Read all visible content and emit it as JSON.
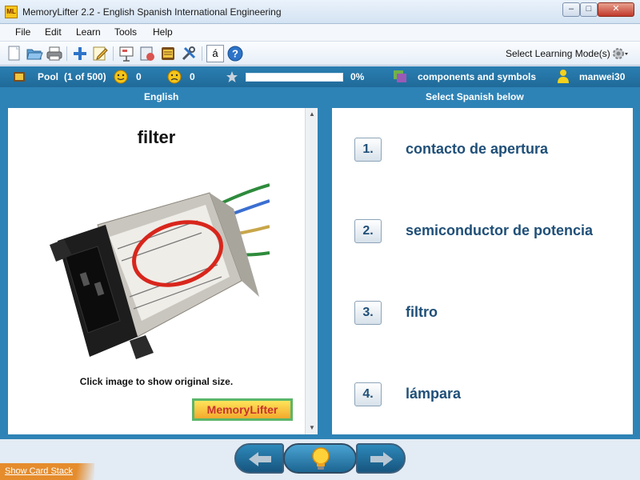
{
  "window": {
    "title": "MemoryLifter 2.2 - English Spanish International Engineering",
    "app_icon_text": "ML"
  },
  "menu": {
    "items": [
      "File",
      "Edit",
      "Learn",
      "Tools",
      "Help"
    ]
  },
  "toolbar": {
    "learning_mode_label": "Select Learning Mode(s)",
    "accent_key_label": "á"
  },
  "status": {
    "pool_label": "Pool",
    "pool_count": "(1 of 500)",
    "right_count": "0",
    "wrong_count": "0",
    "progress_text": "0%",
    "progress_fraction": 0,
    "chapter": "components and symbols",
    "user": "manwei30"
  },
  "question_panel": {
    "header": "English",
    "word": "filter",
    "caption": "Click image to show original size.",
    "logo_text": "MemoryLifter"
  },
  "answer_panel": {
    "header": "Select Spanish below",
    "answers": [
      {
        "num": "1.",
        "text": "contacto de apertura"
      },
      {
        "num": "2.",
        "text": "semiconductor de potencia"
      },
      {
        "num": "3.",
        "text": "filtro"
      },
      {
        "num": "4.",
        "text": "lámpara"
      }
    ]
  },
  "bottom": {
    "show_card_stack": "Show Card Stack"
  },
  "colors": {
    "main_blue": "#2e83b6",
    "answer_text": "#1f4f78",
    "accent_orange": "#e58c2d"
  }
}
